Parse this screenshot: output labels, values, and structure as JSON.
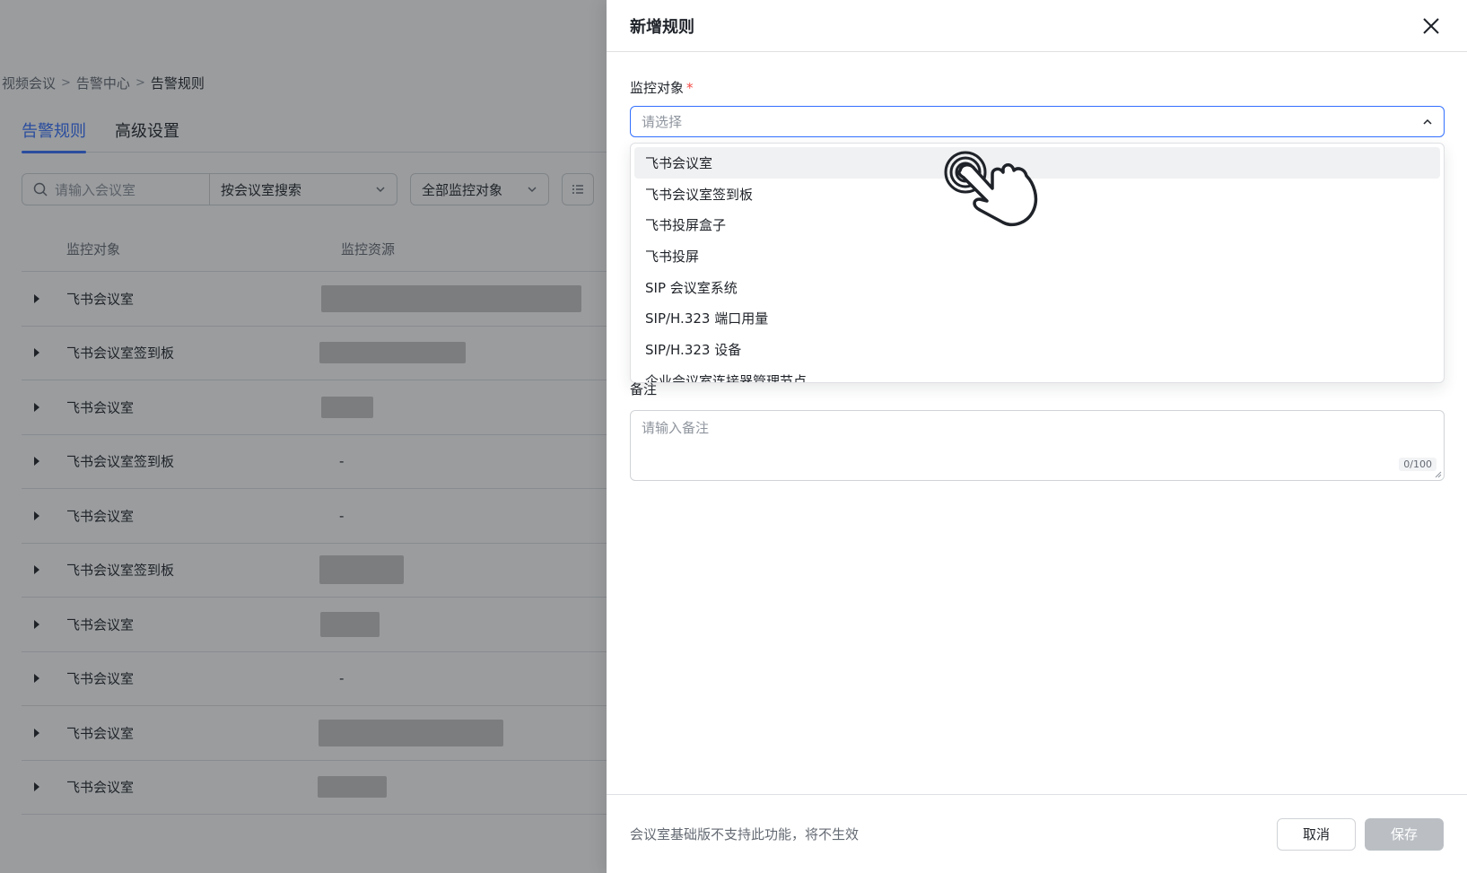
{
  "breadcrumb": {
    "items": [
      "视频会议",
      "告警中心",
      "告警规则"
    ]
  },
  "tabs": {
    "active": "告警规则",
    "other": "高级设置"
  },
  "toolbar": {
    "search_placeholder": "请输入会议室",
    "search_by": "按会议室搜索",
    "monitor_filter": "全部监控对象"
  },
  "table": {
    "headers": {
      "target": "监控对象",
      "resource": "监控资源"
    },
    "rows": [
      {
        "target": "飞书会议室",
        "resource": ""
      },
      {
        "target": "飞书会议室签到板",
        "resource": ""
      },
      {
        "target": "飞书会议室",
        "resource": ""
      },
      {
        "target": "飞书会议室签到板",
        "resource": "-"
      },
      {
        "target": "飞书会议室",
        "resource": "-"
      },
      {
        "target": "飞书会议室签到板",
        "resource": ""
      },
      {
        "target": "飞书会议室",
        "resource": ""
      },
      {
        "target": "飞书会议室",
        "resource": "-"
      },
      {
        "target": "飞书会议室",
        "resource": ""
      },
      {
        "target": "飞书会议室",
        "resource": ""
      }
    ]
  },
  "drawer": {
    "title": "新增规则",
    "monitor_target_label": "监控对象",
    "required_mark": "*",
    "select_placeholder": "请选择",
    "options": [
      "飞书会议室",
      "飞书会议室签到板",
      "飞书投屏盒子",
      "飞书投屏",
      "SIP 会议室系统",
      "SIP/H.323 端口用量",
      "SIP/H.323 设备",
      "企业会议室连接器管理节点"
    ],
    "remark_label": "备注",
    "remark_placeholder": "请输入备注",
    "remark_counter": "0/100",
    "footer_note": "会议室基础版不支持此功能，将不生效",
    "cancel_label": "取消",
    "save_label": "保存"
  }
}
